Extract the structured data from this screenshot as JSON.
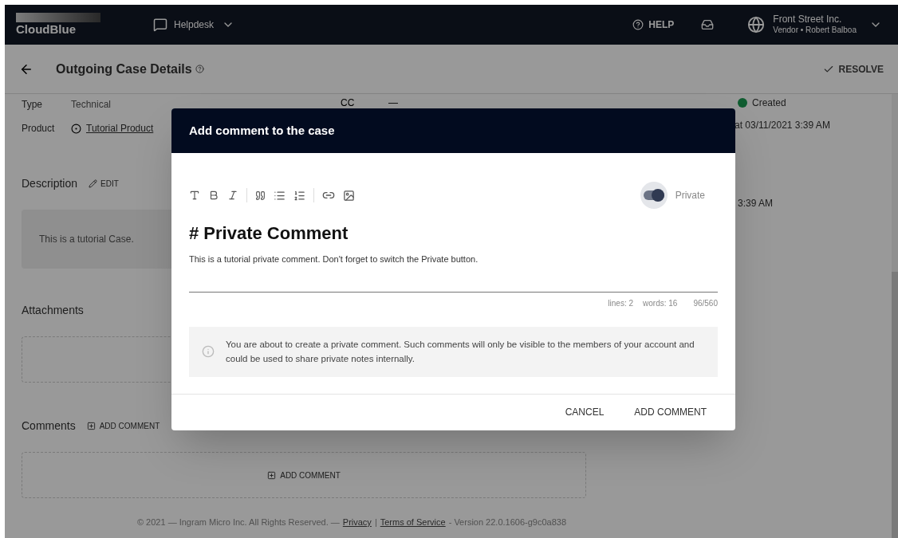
{
  "top_bar": {
    "logo": "CloudBlue",
    "module": "Helpdesk",
    "help": "HELP",
    "account": {
      "name": "Front Street Inc.",
      "role": "Vendor • Robert Balboa"
    }
  },
  "page_header": {
    "title": "Outgoing Case Details",
    "action": "RESOLVE"
  },
  "details": [
    {
      "label": "Type",
      "value": "Technical",
      "kind": "text"
    },
    {
      "label": "Product",
      "value": "Tutorial Product",
      "kind": "link"
    }
  ],
  "cc": {
    "label": "CC",
    "value": "—"
  },
  "activity": [
    {
      "status": "Created",
      "time": "at 03/11/2021 3:39 AM"
    },
    {
      "time": "3:39 AM"
    }
  ],
  "description": {
    "title": "Description",
    "edit": "EDIT",
    "text": "This is a tutorial Case."
  },
  "attachments": {
    "title": "Attachments"
  },
  "comments": {
    "title": "Comments",
    "add": "ADD COMMENT",
    "add_inner": "ADD COMMENT"
  },
  "footer": {
    "copyright": "© 2021 — Ingram Micro Inc. All Rights Reserved. —",
    "privacy": "Privacy",
    "separator": "|",
    "terms": "Terms of Service",
    "version": "- Version 22.0.1606-g9c0a838"
  },
  "dialog": {
    "title": "Add comment to the case",
    "private": {
      "label": "Private",
      "on": true
    },
    "heading": "# Private Comment",
    "body": "This is a tutorial private comment. Don't forget to switch the Private button.",
    "counters": [
      "lines: 2",
      "words: 16",
      "96/560"
    ],
    "notice": "You are about to create a private comment. Such comments will only be visible to the members of your account and could be used to share private notes internally.",
    "buttons": [
      "CANCEL",
      "ADD COMMENT"
    ]
  }
}
